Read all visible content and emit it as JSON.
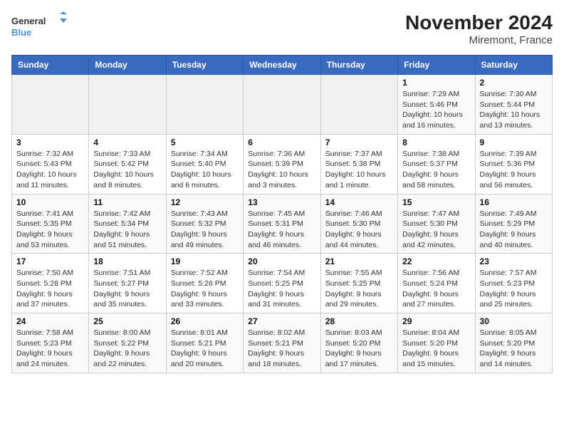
{
  "app": {
    "logo_line1": "General",
    "logo_line2": "Blue",
    "title": "November 2024",
    "subtitle": "Miremont, France"
  },
  "calendar": {
    "headers": [
      "Sunday",
      "Monday",
      "Tuesday",
      "Wednesday",
      "Thursday",
      "Friday",
      "Saturday"
    ],
    "weeks": [
      [
        {
          "day": "",
          "info": ""
        },
        {
          "day": "",
          "info": ""
        },
        {
          "day": "",
          "info": ""
        },
        {
          "day": "",
          "info": ""
        },
        {
          "day": "",
          "info": ""
        },
        {
          "day": "1",
          "info": "Sunrise: 7:29 AM\nSunset: 5:46 PM\nDaylight: 10 hours and 16 minutes."
        },
        {
          "day": "2",
          "info": "Sunrise: 7:30 AM\nSunset: 5:44 PM\nDaylight: 10 hours and 13 minutes."
        }
      ],
      [
        {
          "day": "3",
          "info": "Sunrise: 7:32 AM\nSunset: 5:43 PM\nDaylight: 10 hours and 11 minutes."
        },
        {
          "day": "4",
          "info": "Sunrise: 7:33 AM\nSunset: 5:42 PM\nDaylight: 10 hours and 8 minutes."
        },
        {
          "day": "5",
          "info": "Sunrise: 7:34 AM\nSunset: 5:40 PM\nDaylight: 10 hours and 6 minutes."
        },
        {
          "day": "6",
          "info": "Sunrise: 7:36 AM\nSunset: 5:39 PM\nDaylight: 10 hours and 3 minutes."
        },
        {
          "day": "7",
          "info": "Sunrise: 7:37 AM\nSunset: 5:38 PM\nDaylight: 10 hours and 1 minute."
        },
        {
          "day": "8",
          "info": "Sunrise: 7:38 AM\nSunset: 5:37 PM\nDaylight: 9 hours and 58 minutes."
        },
        {
          "day": "9",
          "info": "Sunrise: 7:39 AM\nSunset: 5:36 PM\nDaylight: 9 hours and 56 minutes."
        }
      ],
      [
        {
          "day": "10",
          "info": "Sunrise: 7:41 AM\nSunset: 5:35 PM\nDaylight: 9 hours and 53 minutes."
        },
        {
          "day": "11",
          "info": "Sunrise: 7:42 AM\nSunset: 5:34 PM\nDaylight: 9 hours and 51 minutes."
        },
        {
          "day": "12",
          "info": "Sunrise: 7:43 AM\nSunset: 5:32 PM\nDaylight: 9 hours and 49 minutes."
        },
        {
          "day": "13",
          "info": "Sunrise: 7:45 AM\nSunset: 5:31 PM\nDaylight: 9 hours and 46 minutes."
        },
        {
          "day": "14",
          "info": "Sunrise: 7:46 AM\nSunset: 5:30 PM\nDaylight: 9 hours and 44 minutes."
        },
        {
          "day": "15",
          "info": "Sunrise: 7:47 AM\nSunset: 5:30 PM\nDaylight: 9 hours and 42 minutes."
        },
        {
          "day": "16",
          "info": "Sunrise: 7:49 AM\nSunset: 5:29 PM\nDaylight: 9 hours and 40 minutes."
        }
      ],
      [
        {
          "day": "17",
          "info": "Sunrise: 7:50 AM\nSunset: 5:28 PM\nDaylight: 9 hours and 37 minutes."
        },
        {
          "day": "18",
          "info": "Sunrise: 7:51 AM\nSunset: 5:27 PM\nDaylight: 9 hours and 35 minutes."
        },
        {
          "day": "19",
          "info": "Sunrise: 7:52 AM\nSunset: 5:26 PM\nDaylight: 9 hours and 33 minutes."
        },
        {
          "day": "20",
          "info": "Sunrise: 7:54 AM\nSunset: 5:25 PM\nDaylight: 9 hours and 31 minutes."
        },
        {
          "day": "21",
          "info": "Sunrise: 7:55 AM\nSunset: 5:25 PM\nDaylight: 9 hours and 29 minutes."
        },
        {
          "day": "22",
          "info": "Sunrise: 7:56 AM\nSunset: 5:24 PM\nDaylight: 9 hours and 27 minutes."
        },
        {
          "day": "23",
          "info": "Sunrise: 7:57 AM\nSunset: 5:23 PM\nDaylight: 9 hours and 25 minutes."
        }
      ],
      [
        {
          "day": "24",
          "info": "Sunrise: 7:58 AM\nSunset: 5:23 PM\nDaylight: 9 hours and 24 minutes."
        },
        {
          "day": "25",
          "info": "Sunrise: 8:00 AM\nSunset: 5:22 PM\nDaylight: 9 hours and 22 minutes."
        },
        {
          "day": "26",
          "info": "Sunrise: 8:01 AM\nSunset: 5:21 PM\nDaylight: 9 hours and 20 minutes."
        },
        {
          "day": "27",
          "info": "Sunrise: 8:02 AM\nSunset: 5:21 PM\nDaylight: 9 hours and 18 minutes."
        },
        {
          "day": "28",
          "info": "Sunrise: 8:03 AM\nSunset: 5:20 PM\nDaylight: 9 hours and 17 minutes."
        },
        {
          "day": "29",
          "info": "Sunrise: 8:04 AM\nSunset: 5:20 PM\nDaylight: 9 hours and 15 minutes."
        },
        {
          "day": "30",
          "info": "Sunrise: 8:05 AM\nSunset: 5:20 PM\nDaylight: 9 hours and 14 minutes."
        }
      ]
    ]
  }
}
